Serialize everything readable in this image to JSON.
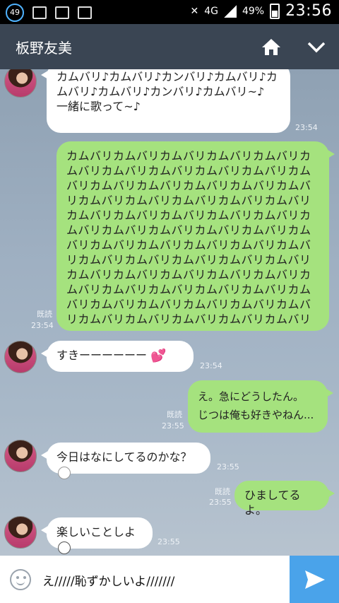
{
  "status_bar": {
    "notification_count": "49",
    "network": "4G",
    "battery": "49%",
    "time": "23:56"
  },
  "header": {
    "title": "板野友美"
  },
  "messages": [
    {
      "side": "in",
      "text": "カムバリ♪カムバリ♪カンバリ♪カムバリ♪カムバリ♪カムバリ♪カンバリ♪カムバリ~♪\n一緒に歌って~♪",
      "time": "23:54"
    },
    {
      "side": "out",
      "text": "カムバリカムバリカムバリカムバリカムバリカムバリカムバリカムバリカムバリカムバリカムバリカムバリカムバリカムバリカムバリカムバリカムバリカムバリカムバリカムバリカムバリカムバリカムバリカムバリカムバリカムバリカムバリカムバリカムバリカムバリカムバリカムバリカムバリカムバリカムバリカムバリカムバリカムバリカムバリカムバリカムバリカムバリカムバリカムバリカムバリカムバリカムバリカムバリカムバリカムバリカムバリカムバリカムバリカムバリカムバリカムバリカムバリカムバリカムバリカムバリカムバリカムバリカムバリ",
      "read": "既読",
      "time": "23:54"
    },
    {
      "side": "in",
      "text": "すきーーーーーー",
      "time": "23:54"
    },
    {
      "side": "out",
      "text": "え。急にどうしたん。\nじつは俺も好きやねん...",
      "read": "既読",
      "time": "23:55"
    },
    {
      "side": "in",
      "text": "今日はなにしてるのかな？",
      "time": "23:55"
    },
    {
      "side": "out",
      "text": "ひましてるよ。",
      "read": "既読",
      "time": "23:55"
    },
    {
      "side": "in",
      "text": "楽しいことしよ",
      "time": "23:55"
    }
  ],
  "input": {
    "value": "え/////恥ずかしいよ///////"
  },
  "colors": {
    "header_bg": "#3a4553",
    "outgoing_bubble": "#a5e27e",
    "incoming_bubble": "#ffffff",
    "send_button": "#4aa3ea"
  }
}
